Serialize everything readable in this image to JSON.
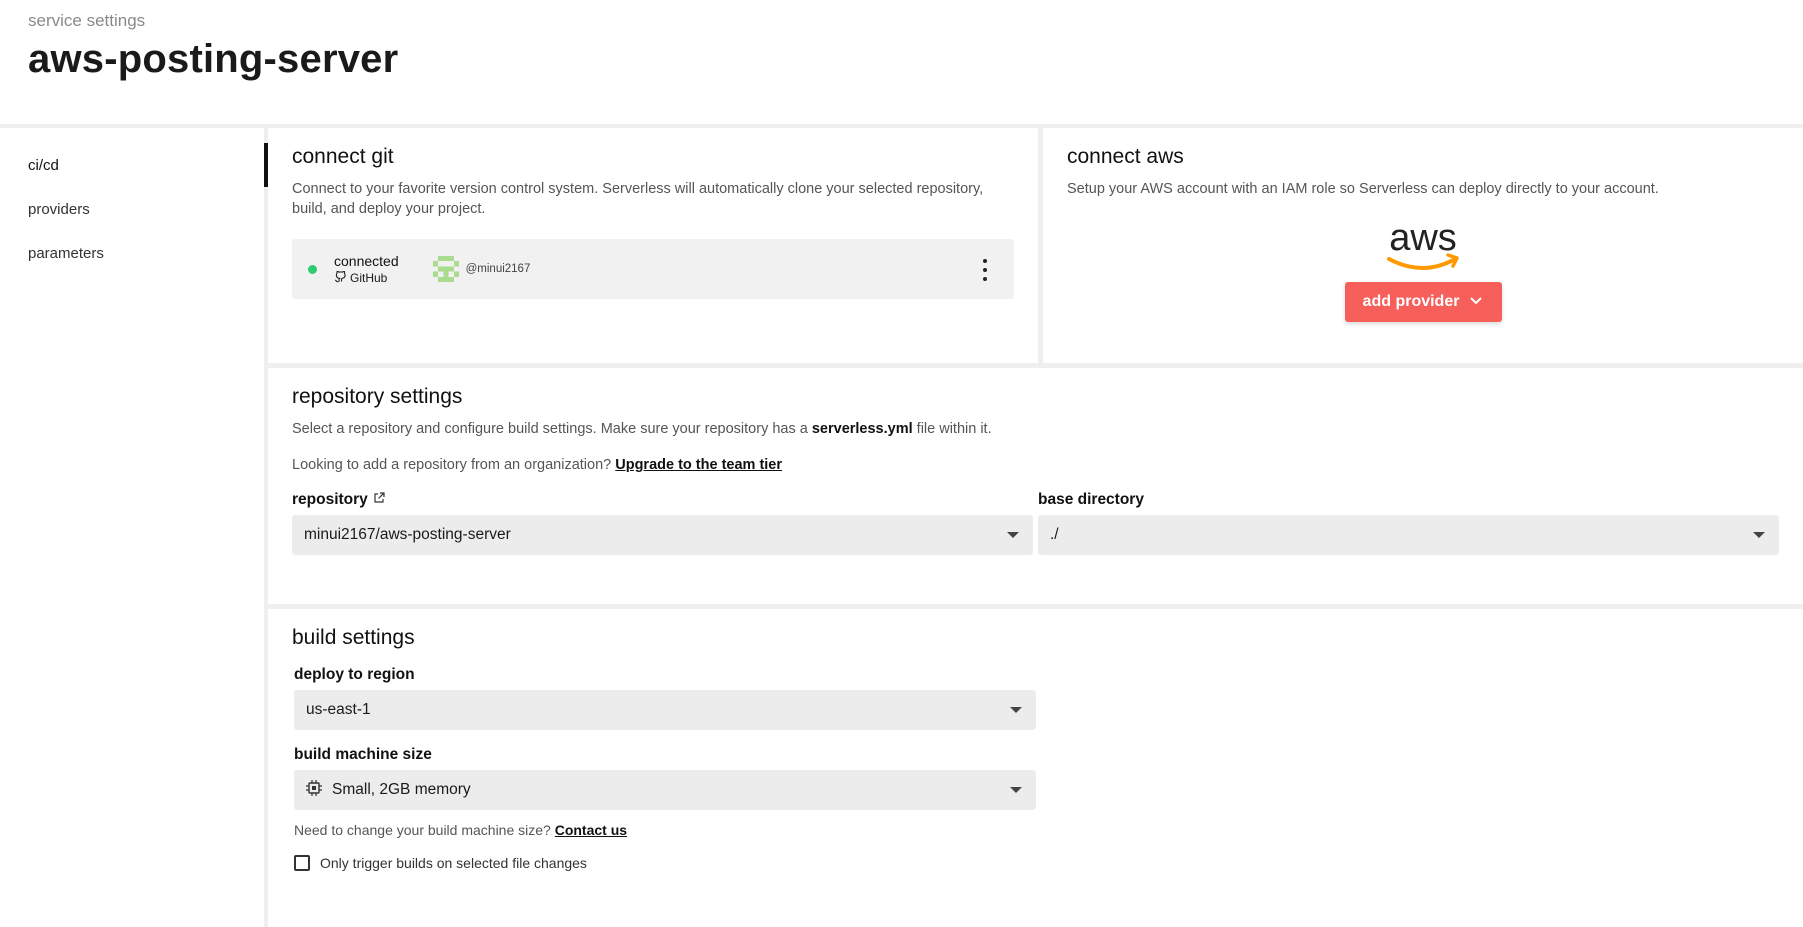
{
  "header": {
    "kicker": "service settings",
    "title": "aws-posting-server"
  },
  "sidebar": {
    "items": [
      {
        "label": "ci/cd"
      },
      {
        "label": "providers"
      },
      {
        "label": "parameters"
      }
    ]
  },
  "git": {
    "title": "connect git",
    "description": "Connect to your favorite version control system. Serverless will automatically clone your selected repository, build, and deploy your project.",
    "status": "connected",
    "provider": "GitHub",
    "handle": "@minui2167"
  },
  "aws": {
    "title": "connect aws",
    "description": "Setup your AWS account with an IAM role so Serverless can deploy directly to your account.",
    "logo_text": "aws",
    "add_label": "add provider"
  },
  "repo": {
    "title": "repository settings",
    "desc_pre": "Select a repository and configure build settings. Make sure your repository has a ",
    "desc_file": "serverless.yml",
    "desc_post": " file within it.",
    "org_text": "Looking to add a repository from an organization? ",
    "org_link": "Upgrade to the team tier",
    "repo_label": "repository",
    "repo_value": "minui2167/aws-posting-server",
    "dir_label": "base directory",
    "dir_value": "./"
  },
  "build": {
    "title": "build settings",
    "region_label": "deploy to region",
    "region_value": "us-east-1",
    "size_label": "build machine size",
    "size_value": "Small, 2GB memory",
    "note_text": "Need to change your build machine size? ",
    "note_link": "Contact us",
    "checkbox_label": "Only trigger builds on selected file changes",
    "checkbox_checked": false
  },
  "colors": {
    "accent": "#f75f5a",
    "connected": "#2ecc71",
    "aws_orange": "#f90"
  }
}
